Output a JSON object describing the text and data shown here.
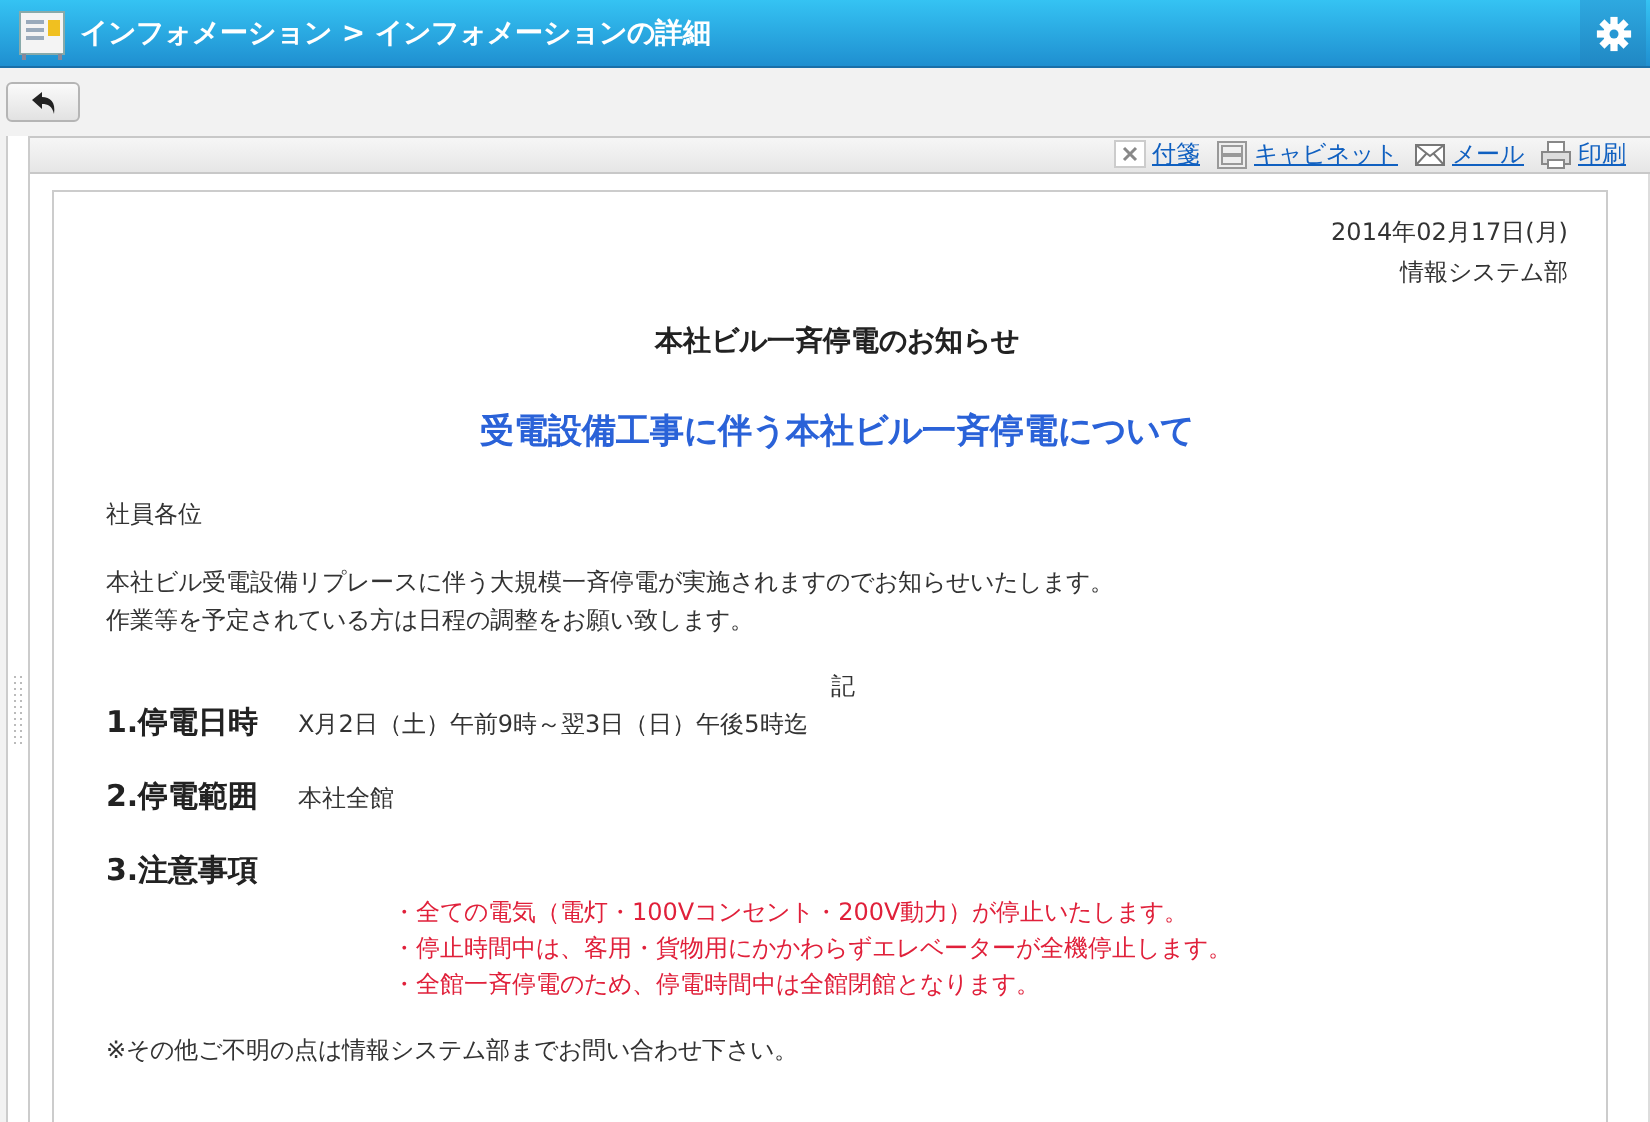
{
  "header": {
    "title": "インフォメーション > インフォメーションの詳細"
  },
  "actions": [
    {
      "kind": "note",
      "label": "付箋"
    },
    {
      "kind": "cabinet",
      "label": "キャビネット"
    },
    {
      "kind": "mail",
      "label": "メール"
    },
    {
      "kind": "print",
      "label": "印刷"
    }
  ],
  "document": {
    "date": "2014年02月17日(月)",
    "department": "情報システム部",
    "title": "本社ビル一斉停電のお知らせ",
    "subtitle": "受電設備工事に伴う本社ビル一斉停電について",
    "salutation": "社員各位",
    "body_lines": [
      "本社ビル受電設備リプレースに伴う大規模一斉停電が実施されますのでお知らせいたします。",
      "作業等を予定されている方は日程の調整をお願い致します。"
    ],
    "note_mark": "記",
    "items": [
      {
        "heading": "1.停電日時",
        "text": "X月2日（土）午前9時～翌3日（日）午後5時迄"
      },
      {
        "heading": "2.停電範囲",
        "text": "本社全館"
      },
      {
        "heading": "3.注意事項",
        "notes": [
          "・全ての電気（電灯・100Vコンセント・200V動力）が停止いたします。",
          "・停止時間中は、客用・貨物用にかかわらずエレベーターが全機停止します。",
          "・全館一斉停電のため、停電時間中は全館閉館となります。"
        ]
      }
    ],
    "footer": "※その他ご不明の点は情報システム部までお問い合わせ下さい。"
  }
}
